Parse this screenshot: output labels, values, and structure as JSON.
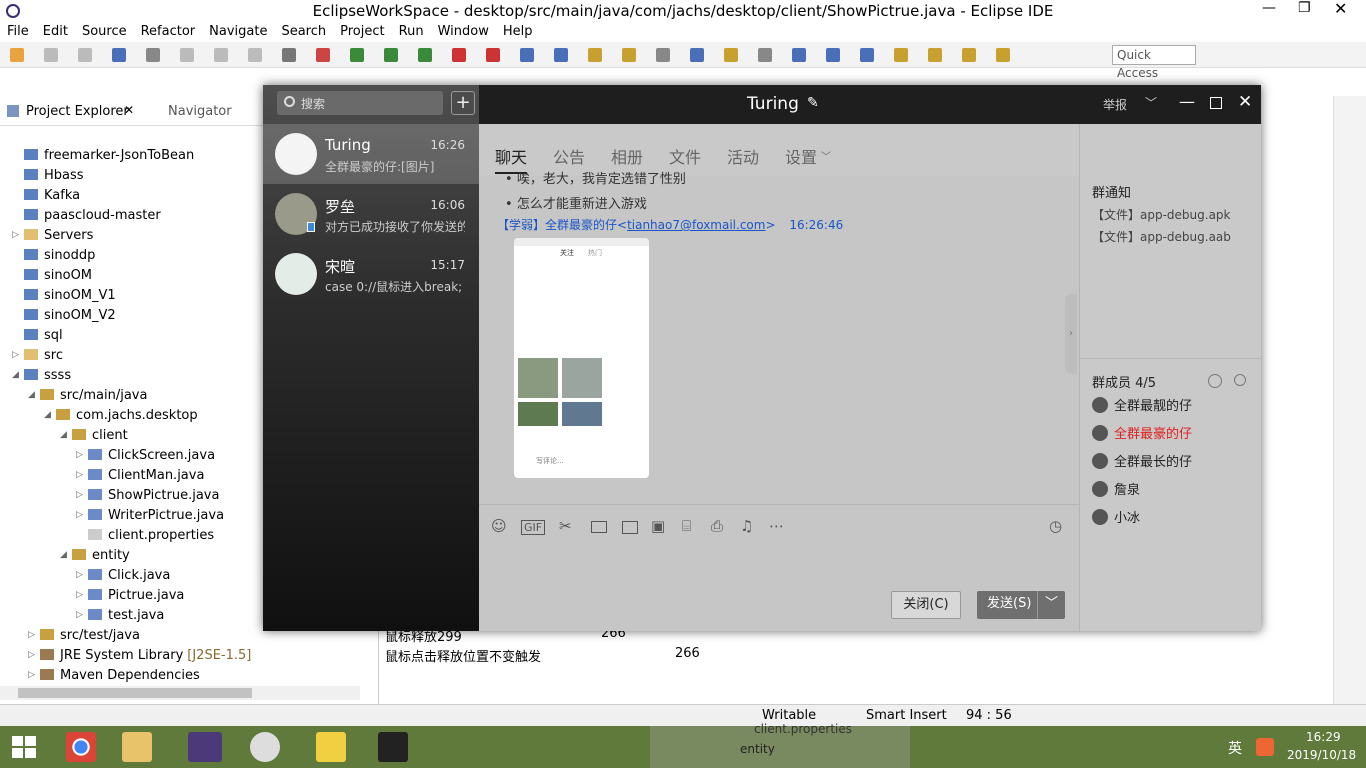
{
  "window": {
    "title": "EclipseWorkSpace - desktop/src/main/java/com/jachs/desktop/client/ShowPictrue.java - Eclipse IDE"
  },
  "menu": [
    "File",
    "Edit",
    "Source",
    "Refactor",
    "Navigate",
    "Search",
    "Project",
    "Run",
    "Window",
    "Help"
  ],
  "quick_access": "Quick Access",
  "panel": {
    "tab_explorer": "Project Explorer",
    "tab_navigator": "Navigator"
  },
  "tree": [
    {
      "label": "freemarker-JsonToBean",
      "indent": 0,
      "type": "proj"
    },
    {
      "label": "Hbass",
      "indent": 0,
      "type": "proj"
    },
    {
      "label": "Kafka",
      "indent": 0,
      "type": "proj"
    },
    {
      "label": "paascloud-master",
      "indent": 0,
      "type": "proj"
    },
    {
      "label": "Servers",
      "indent": 0,
      "type": "folder",
      "arrow": "▷"
    },
    {
      "label": "sinoddp",
      "indent": 0,
      "type": "proj"
    },
    {
      "label": "sinoOM",
      "indent": 0,
      "type": "proj"
    },
    {
      "label": "sinoOM_V1",
      "indent": 0,
      "type": "proj"
    },
    {
      "label": "sinoOM_V2",
      "indent": 0,
      "type": "proj"
    },
    {
      "label": "sql",
      "indent": 0,
      "type": "proj"
    },
    {
      "label": "src",
      "indent": 0,
      "type": "folder",
      "arrow": "▷"
    },
    {
      "label": "ssss",
      "indent": 0,
      "type": "proj",
      "arrow": "◢"
    },
    {
      "label": "src/main/java",
      "indent": 1,
      "type": "pkgroot",
      "arrow": "◢"
    },
    {
      "label": "com.jachs.desktop",
      "indent": 2,
      "type": "pkg",
      "arrow": "◢"
    },
    {
      "label": "client",
      "indent": 3,
      "type": "pkg",
      "arrow": "◢"
    },
    {
      "label": "ClickScreen.java",
      "indent": 4,
      "type": "java",
      "arrow": "▷"
    },
    {
      "label": "ClientMan.java",
      "indent": 4,
      "type": "java",
      "arrow": "▷"
    },
    {
      "label": "ShowPictrue.java",
      "indent": 4,
      "type": "java",
      "arrow": "▷"
    },
    {
      "label": "WriterPictrue.java",
      "indent": 4,
      "type": "java",
      "arrow": "▷"
    },
    {
      "label": "client.properties",
      "indent": 4,
      "type": "file"
    },
    {
      "label": "entity",
      "indent": 3,
      "type": "pkg",
      "arrow": "◢"
    },
    {
      "label": "Click.java",
      "indent": 4,
      "type": "java",
      "arrow": "▷"
    },
    {
      "label": "Pictrue.java",
      "indent": 4,
      "type": "java",
      "arrow": "▷"
    },
    {
      "label": "test.java",
      "indent": 4,
      "type": "java",
      "arrow": "▷"
    },
    {
      "label": "src/test/java",
      "indent": 1,
      "type": "pkgroot",
      "arrow": "▷"
    },
    {
      "label": "JRE System Library",
      "suffix": "[J2SE-1.5]",
      "indent": 1,
      "type": "lib",
      "arrow": "▷"
    },
    {
      "label": "Maven Dependencies",
      "indent": 1,
      "type": "lib",
      "arrow": "▷"
    }
  ],
  "console": [
    {
      "text": "鼠标释放299",
      "val": "266"
    },
    {
      "text": "鼠标点击释放位置不变触发",
      "val": "266"
    }
  ],
  "status": {
    "mode": "Writable",
    "insert": "Smart Insert",
    "pos": "94 : 56"
  },
  "taskbar": {
    "time": "16:29",
    "date": "2019/10/18",
    "ime": "英",
    "behind_entity": "entity",
    "behind_props": "client.properties"
  },
  "qq": {
    "title": "Turing",
    "report": "举报",
    "search_placeholder": "搜索",
    "conversations": [
      {
        "name": "Turing",
        "time": "16:26",
        "preview": "全群最豪的仔:[图片]"
      },
      {
        "name": "罗垒",
        "time": "16:06",
        "preview": "对方已成功接收了你发送的"
      },
      {
        "name": "宋暄",
        "time": "15:17",
        "preview": "case 0://鼠标进入break;"
      }
    ],
    "tabs": [
      "聊天",
      "公告",
      "相册",
      "文件",
      "活动",
      "设置"
    ],
    "messages": {
      "line1": "唉，老大，我肯定选错了性别",
      "line2": "怎么才能重新进入游戏",
      "sender_tag": "【学弱】全群最豪的仔<",
      "sender_email": "tianhao7@foxmail.com",
      "sender_close": ">",
      "sender_time": "16:26:46"
    },
    "notice_title": "群通知",
    "notices": [
      "【文件】app-debug.apk",
      "【文件】app-debug.aab"
    ],
    "members_title": "群成员 4/5",
    "members": [
      {
        "name": "全群最靓的仔",
        "color": "#222222"
      },
      {
        "name": "全群最豪的仔",
        "color": "#e02020"
      },
      {
        "name": "全群最长的仔",
        "color": "#222222"
      },
      {
        "name": "詹泉",
        "color": "#222222"
      },
      {
        "name": "小冰",
        "color": "#222222"
      }
    ],
    "btn_close": "关闭(C)",
    "btn_send": "发送(S)"
  },
  "screenshot_text": {
    "follow": "关注",
    "hot": "热门",
    "compose": "写评论..."
  }
}
